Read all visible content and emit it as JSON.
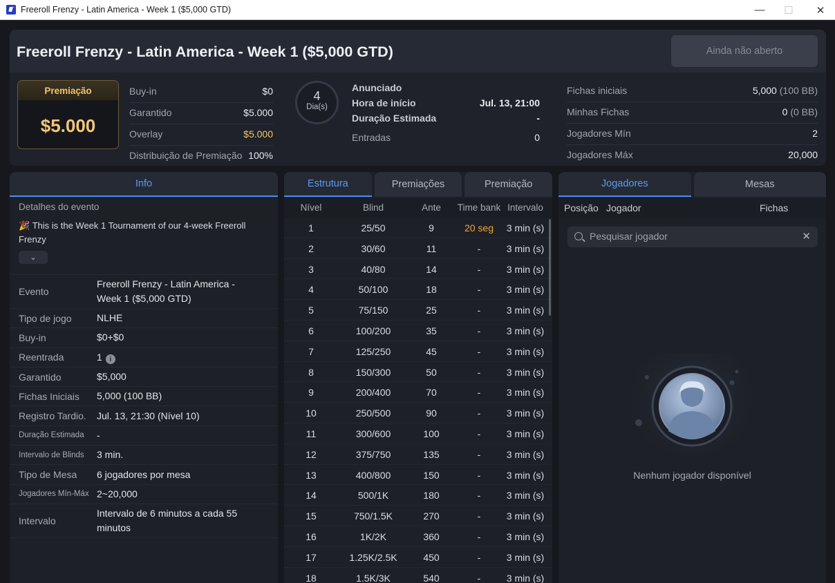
{
  "window": {
    "title": "Freeroll Frenzy - Latin America - Week 1 ($5,000 GTD)",
    "min_glyph": "—",
    "max_glyph": "☐",
    "close_glyph": "✕"
  },
  "header": {
    "title": "Freeroll Frenzy - Latin America - Week 1 ($5,000 GTD)",
    "register_button": "Ainda não aberto"
  },
  "summary": {
    "prize_label": "Premiação",
    "prize_value": "$5.000",
    "buyin_label": "Buy-in",
    "buyin_value": "$0",
    "guaranteed_label": "Garantido",
    "guaranteed_value": "$5.000",
    "overlay_label": "Overlay",
    "overlay_value": "$5.000",
    "distribution_label": "Distribuição de Premiação",
    "distribution_value": "100%",
    "day_number": "4",
    "day_label": "Dia(s)",
    "status": "Anunciado",
    "start_label": "Hora de início",
    "start_value": "Jul. 13, 21:00",
    "duration_label": "Duração Estimada",
    "duration_value": "-",
    "entries_label": "Entradas",
    "entries_value": "0",
    "starting_chips_label": "Fichas iniciais",
    "starting_chips_value": "5,000",
    "starting_chips_bb": "(100 BB)",
    "my_chips_label": "Minhas Fichas",
    "my_chips_value": "0",
    "my_chips_bb": "(0 BB)",
    "min_players_label": "Jogadores Mín",
    "min_players_value": "2",
    "max_players_label": "Jogadores Máx",
    "max_players_value": "20,000"
  },
  "info_panel": {
    "tab": "Info",
    "details_heading": "Detalhes do evento",
    "details_text": "🎉 This is the Week 1 Tournament of our 4-week Freeroll Frenzy",
    "expand_glyph": "⌄",
    "rows": [
      {
        "label": "Evento",
        "value": "Freeroll Frenzy - Latin America - Week 1 ($5,000 GTD)"
      },
      {
        "label": "Tipo de jogo",
        "value": "NLHE"
      },
      {
        "label": "Buy-in",
        "value": "$0+$0"
      },
      {
        "label": "Reentrada",
        "value": "1"
      },
      {
        "label": "Garantido",
        "value": "$5,000"
      },
      {
        "label": "Fichas Iniciais",
        "value": "5,000 (100 BB)"
      },
      {
        "label": "Registro Tardio.",
        "value": "Jul. 13, 21:30 (Nível 10)"
      },
      {
        "label": "Duração Estimada",
        "value": "-"
      },
      {
        "label": "Intervalo de Blinds",
        "value": "3 min."
      },
      {
        "label": "Tipo de Mesa",
        "value": "6 jogadores por mesa"
      },
      {
        "label": "Jogadores Mín-Máx",
        "value": "2~20,000"
      },
      {
        "label": "Intervalo",
        "value": "Intervalo de 6 minutos a cada 55 minutos"
      }
    ],
    "info_glyph": "i"
  },
  "structure_panel": {
    "tabs": [
      "Estrutura",
      "Premiações",
      "Premiação"
    ],
    "headers": [
      "Nível",
      "Blind",
      "Ante",
      "Time bank",
      "Intervalo"
    ],
    "rows": [
      [
        "1",
        "25/50",
        "9",
        "20 seg",
        "3  min (s)"
      ],
      [
        "2",
        "30/60",
        "11",
        "-",
        "3  min (s)"
      ],
      [
        "3",
        "40/80",
        "14",
        "-",
        "3  min (s)"
      ],
      [
        "4",
        "50/100",
        "18",
        "-",
        "3  min (s)"
      ],
      [
        "5",
        "75/150",
        "25",
        "-",
        "3  min (s)"
      ],
      [
        "6",
        "100/200",
        "35",
        "-",
        "3  min (s)"
      ],
      [
        "7",
        "125/250",
        "45",
        "-",
        "3  min (s)"
      ],
      [
        "8",
        "150/300",
        "50",
        "-",
        "3  min (s)"
      ],
      [
        "9",
        "200/400",
        "70",
        "-",
        "3  min (s)"
      ],
      [
        "10",
        "250/500",
        "90",
        "-",
        "3  min (s)"
      ],
      [
        "11",
        "300/600",
        "100",
        "-",
        "3  min (s)"
      ],
      [
        "12",
        "375/750",
        "135",
        "-",
        "3  min (s)"
      ],
      [
        "13",
        "400/800",
        "150",
        "-",
        "3  min (s)"
      ],
      [
        "14",
        "500/1K",
        "180",
        "-",
        "3  min (s)"
      ],
      [
        "15",
        "750/1.5K",
        "270",
        "-",
        "3  min (s)"
      ],
      [
        "16",
        "1K/2K",
        "360",
        "-",
        "3  min (s)"
      ],
      [
        "17",
        "1.25K/2.5K",
        "450",
        "-",
        "3  min (s)"
      ],
      [
        "18",
        "1.5K/3K",
        "540",
        "-",
        "3  min (s)"
      ]
    ]
  },
  "players_panel": {
    "tabs": [
      "Jogadores",
      "Mesas"
    ],
    "headers": [
      "Posição",
      "Jogador",
      "Fichas"
    ],
    "search_placeholder": "Pesquisar jogador",
    "clear_glyph": "✕",
    "empty_text": "Nenhum jogador disponível"
  },
  "colors": {
    "accent_blue": "#4c8ff0",
    "gold": "#f2c46d",
    "time_bank_orange": "#f2a43a"
  },
  "icons": [
    "app-icon",
    "chevron-down-icon",
    "info-icon",
    "search-icon",
    "close-icon",
    "avatar-placeholder-icon"
  ]
}
